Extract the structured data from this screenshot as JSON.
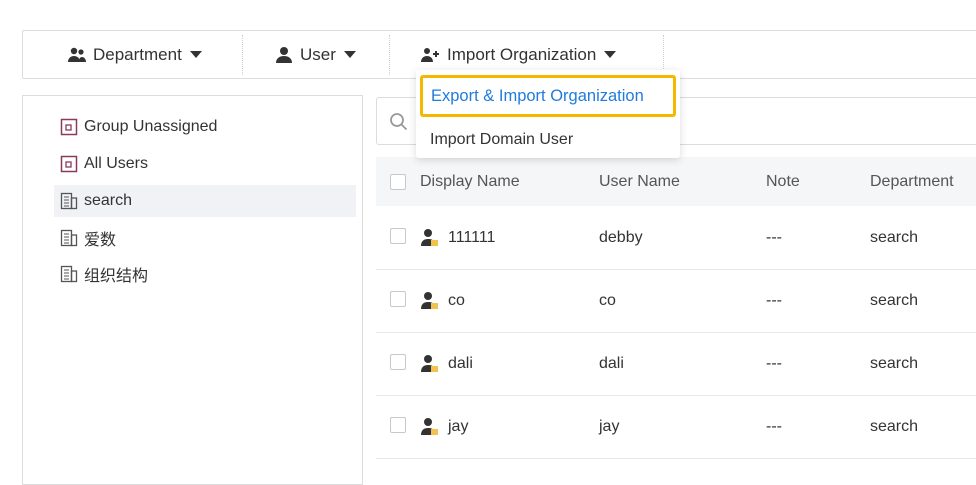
{
  "toolbar": {
    "department_label": "Department",
    "user_label": "User",
    "import_label": "Import Organization"
  },
  "dropdown": {
    "items": [
      {
        "label": "Export & Import Organization"
      },
      {
        "label": "Import Domain User"
      }
    ]
  },
  "tree": {
    "items": [
      {
        "label": "Group Unassigned"
      },
      {
        "label": "All Users"
      },
      {
        "label": "search"
      },
      {
        "label": "爱数"
      },
      {
        "label": "组织结构"
      }
    ]
  },
  "table": {
    "headers": [
      "Display Name",
      "User Name",
      "Note",
      "Department"
    ],
    "rows": [
      {
        "display": "111111",
        "user": "debby",
        "note": "---",
        "dept": "search"
      },
      {
        "display": "co",
        "user": "co",
        "note": "---",
        "dept": "search"
      },
      {
        "display": "dali",
        "user": "dali",
        "note": "---",
        "dept": "search"
      },
      {
        "display": "jay",
        "user": "jay",
        "note": "---",
        "dept": "search"
      }
    ]
  },
  "colors": {
    "accent": "#1f7bdc",
    "highlight_border": "#f5b800"
  }
}
